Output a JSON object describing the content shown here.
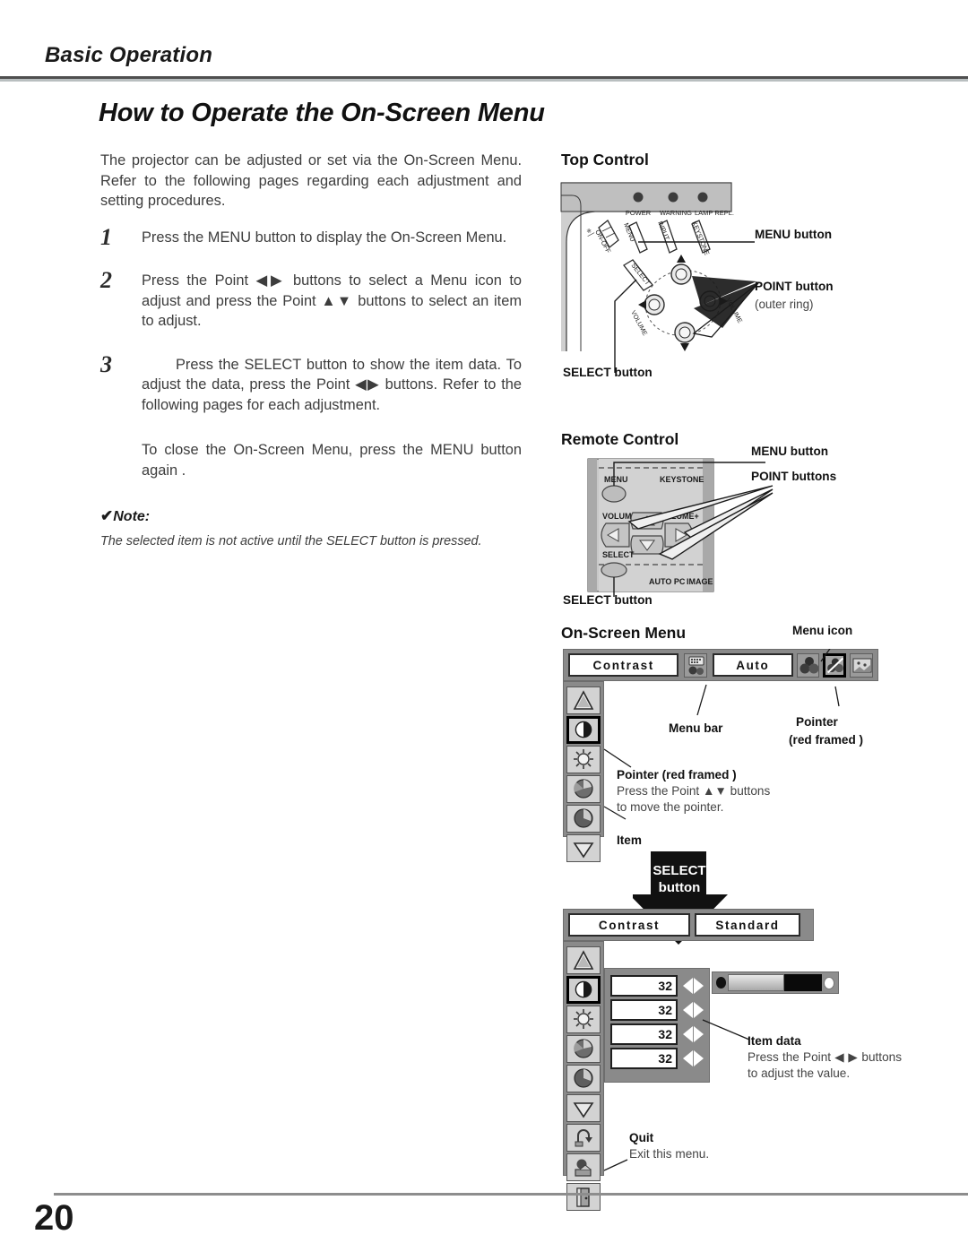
{
  "header": {
    "running_head": "Basic Operation",
    "page_title": "How to Operate the On-Screen Menu"
  },
  "intro": {
    "paragraph": "The projector can be adjusted or set via the On-Screen Menu. Refer to the following pages regarding each adjustment and setting procedures."
  },
  "steps": [
    {
      "number": "1",
      "text": "Press the MENU button to display the On-Screen Menu."
    },
    {
      "number": "2",
      "text": "Press the Point ◀▶ buttons to select a Menu icon to adjust and press the Point ▲▼ buttons to select an item to adjust."
    },
    {
      "number": "3",
      "text": "Press the SELECT button to show the item data.  To adjust the data, press the Point ◀▶ buttons. Refer to the following pages for each adjustment."
    }
  ],
  "closing": {
    "text": "To close the On-Screen Menu, press the MENU button again ."
  },
  "note": {
    "check": "✔",
    "title": "Note:",
    "body": "The selected item is not active until the SELECT button is pressed."
  },
  "top_control": {
    "heading": "Top Control",
    "indicators": [
      "POWER",
      "WARNING",
      "LAMP REPL"
    ],
    "buttons": [
      "ON-OFF",
      "MENU",
      "INPUT",
      "KEYSTONE",
      "SELECT",
      "VOLUME-",
      "VOLUME+"
    ],
    "callouts": {
      "menu": "MENU button",
      "point": "POINT button",
      "point_sub": "(outer ring)",
      "select": "SELECT button"
    }
  },
  "remote_control": {
    "heading": "Remote Control",
    "keys": [
      "MENU",
      "KEYSTONE",
      "VOLUME-",
      "VOLUME+",
      "SELECT",
      "AUTO PC",
      "IMAGE"
    ],
    "callouts": {
      "menu": "MENU button",
      "point": "POINT buttons",
      "select": "SELECT button"
    }
  },
  "onscreen_menu": {
    "heading": "On-Screen Menu",
    "callouts": {
      "menu_icon": "Menu icon",
      "menu_bar": "Menu bar",
      "pointer": "Pointer",
      "pointer_sub": "(red framed )",
      "pointer_item_title": "Pointer (red framed )",
      "pointer_item_desc_1": "Press the Point ▲▼ buttons",
      "pointer_item_desc_2": "to move the pointer.",
      "item": "Item",
      "item_data_title": "Item data",
      "item_data_desc": "Press the Point ◀ ▶ buttons to adjust the value.",
      "quit_title": "Quit",
      "quit_desc": "Exit this menu.",
      "select_button_line1": "SELECT",
      "select_button_line2": "button"
    },
    "menu_top": {
      "field_left": "Contrast",
      "field_right": "Auto"
    },
    "menu_bottom": {
      "field_left": "Contrast",
      "field_right": "Standard"
    },
    "values": [
      "32",
      "32",
      "32",
      "32"
    ],
    "slider_percent": 58
  },
  "footer": {
    "page_number": "20"
  },
  "colors": {
    "osd_gray": "#8a8a8a",
    "icon_gray": "#9a9a9a",
    "rule_dark": "#4f4f4f",
    "rule_light": "#b9bfc0",
    "text": "#3d3d3d"
  }
}
